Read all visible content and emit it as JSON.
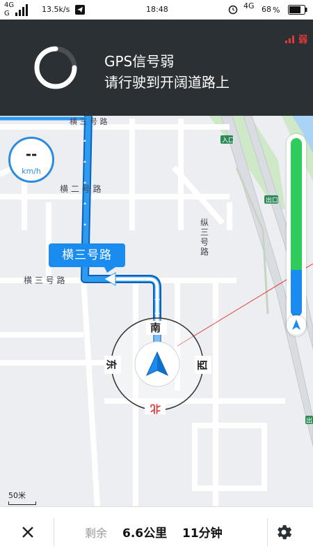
{
  "status_bar": {
    "network1": "4G",
    "network2": "G",
    "speed": "13.5k/s",
    "time": "18:48",
    "network3": "4G",
    "battery": "68"
  },
  "banner": {
    "line1": "GPS信号弱",
    "line2": "请行驶到开阔道路上",
    "signal_badge": "弱"
  },
  "speed": {
    "value": "--",
    "unit": "km/h"
  },
  "map": {
    "road_callout": "横三号路",
    "labels": {
      "heng3_top": "横 三 号 路",
      "heng3_left": "横 三 号 路",
      "heng2": "横 二 号 路",
      "zong3": "纵三号路",
      "exit1": "入口",
      "exit2": "出口",
      "exit3": "出"
    },
    "compass": {
      "n": "北",
      "s": "南",
      "e": "东",
      "w": "西"
    },
    "scale": "50米"
  },
  "route_progress": 0.26,
  "bottom_bar": {
    "remaining_label": "剩余",
    "distance": "6.6公里",
    "duration": "11分钟"
  },
  "colors": {
    "route": "#1a8cf0",
    "banner_bg": "#2b3035",
    "progress_green": "#2ecc5a",
    "progress_blue": "#1a8cf0",
    "north": "#e53935"
  }
}
